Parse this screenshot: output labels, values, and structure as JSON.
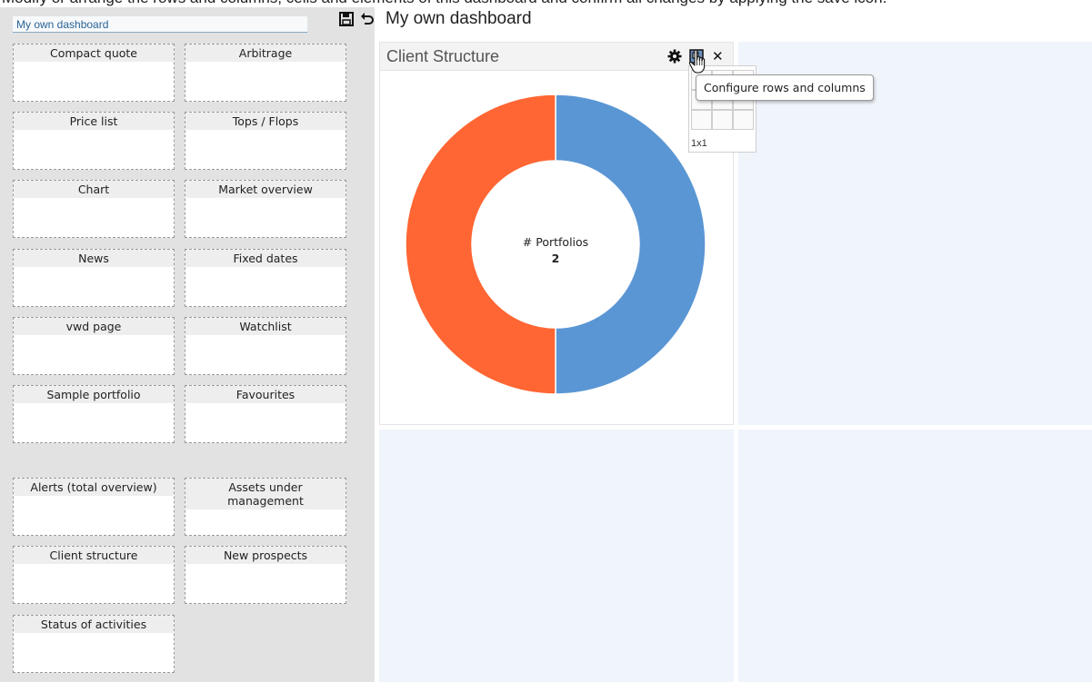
{
  "top_caption": "Modify or arrange the rows and columns, cells and elements of this dashboard and confirm all changes by applying the save icon.",
  "dashboard_selector": {
    "value": "My own dashboard"
  },
  "header": {
    "save_icon": "floppy-disk-icon",
    "undo_icon": "undo-arrow-icon",
    "title": "My own dashboard"
  },
  "widget_palette": [
    {
      "label": "Compact quote"
    },
    {
      "label": "Arbitrage"
    },
    {
      "label": "Price list"
    },
    {
      "label": "Tops / Flops"
    },
    {
      "label": "Chart"
    },
    {
      "label": "Market overview"
    },
    {
      "label": "News"
    },
    {
      "label": "Fixed dates"
    },
    {
      "label": "vwd page"
    },
    {
      "label": "Watchlist"
    },
    {
      "label": "Sample portfolio"
    },
    {
      "label": "Favourites"
    },
    {
      "label": "Alerts (total overview)"
    },
    {
      "label": "Assets under management"
    },
    {
      "label": "Client structure"
    },
    {
      "label": "New prospects"
    },
    {
      "label": "Status of activities"
    }
  ],
  "widget": {
    "title": "Client Structure",
    "icons": [
      "gear-icon",
      "layout-icon",
      "close-icon"
    ],
    "center_label": "# Portfolios",
    "center_value": "2"
  },
  "grid_popup": {
    "dimension": "1x1"
  },
  "tooltip": {
    "text": "Configure rows and columns"
  },
  "chart_data": {
    "type": "pie",
    "title": "",
    "slices": [
      {
        "value": 1,
        "color": "#5b96d4"
      },
      {
        "value": 1,
        "color": "#ff6633"
      }
    ]
  }
}
